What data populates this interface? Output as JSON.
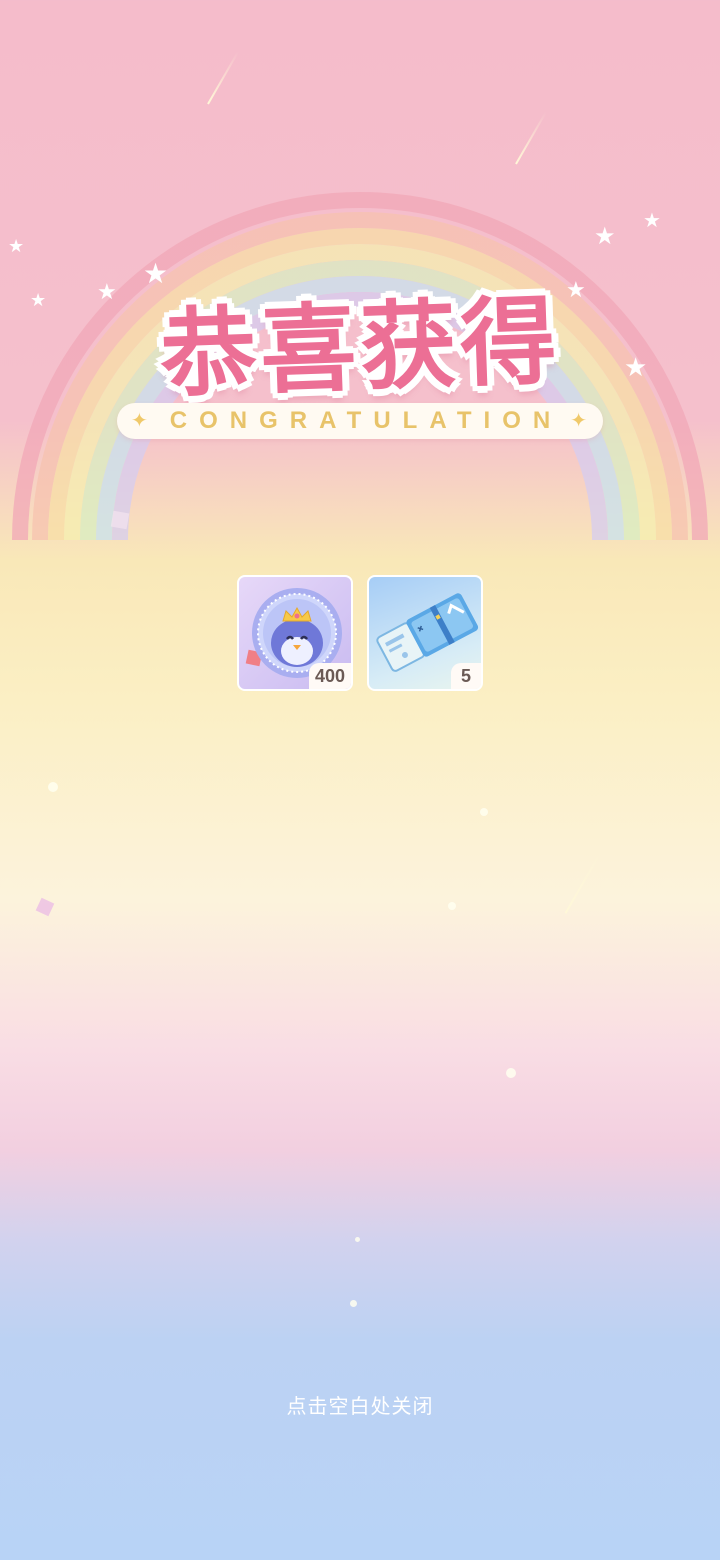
{
  "popup": {
    "title": "恭喜获得",
    "subtitle": "CONGRATULATION",
    "sparkle_icon": "✦",
    "close_hint": "点击空白处关闭"
  },
  "rewards": [
    {
      "icon": "penguin-coin-icon",
      "count": "400"
    },
    {
      "icon": "ticket-icon",
      "count": "5"
    }
  ],
  "colors": {
    "title_pink": "#ec6f95",
    "subtitle_gold": "#e8c36a",
    "bg_top": "#f5bccb",
    "bg_bottom": "#b8d3f6"
  }
}
